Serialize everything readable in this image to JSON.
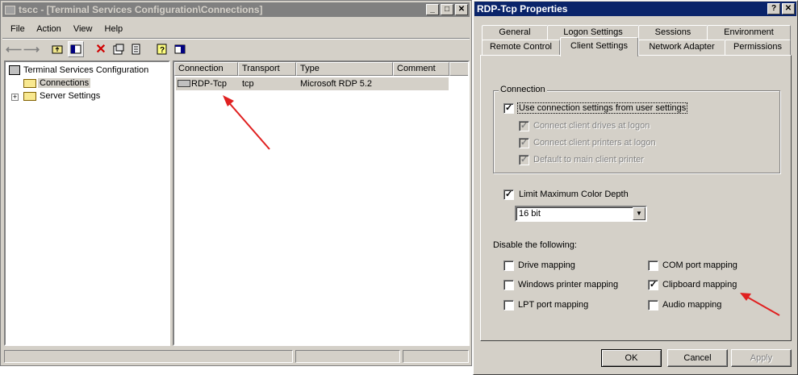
{
  "main_window": {
    "title": "tscc - [Terminal Services Configuration\\Connections]",
    "menu": [
      "File",
      "Action",
      "View",
      "Help"
    ],
    "tree": {
      "root": "Terminal Services Configuration",
      "items": [
        "Connections",
        "Server Settings"
      ]
    },
    "columns": [
      "Connection",
      "Transport",
      "Type",
      "Comment"
    ],
    "rows": [
      {
        "connection": "RDP-Tcp",
        "transport": "tcp",
        "type": "Microsoft RDP 5.2",
        "comment": ""
      }
    ]
  },
  "dialog": {
    "title": "RDP-Tcp Properties",
    "tabs_row1": [
      "General",
      "Logon Settings",
      "Sessions",
      "Environment"
    ],
    "tabs_row2": [
      "Remote Control",
      "Client Settings",
      "Network Adapter",
      "Permissions"
    ],
    "active_tab": "Client Settings",
    "connection_group": {
      "label": "Connection",
      "use_user_settings": {
        "label": "Use connection settings from user settings",
        "checked": true
      },
      "sub_options": [
        {
          "label": "Connect client drives at logon",
          "checked": true
        },
        {
          "label": "Connect client printers at logon",
          "checked": true
        },
        {
          "label": "Default to main client printer",
          "checked": true
        }
      ]
    },
    "color_depth": {
      "label": "Limit Maximum Color Depth",
      "checked": true,
      "value": "16 bit"
    },
    "disable_label": "Disable the following:",
    "disable_left": [
      {
        "label": "Drive mapping",
        "checked": false
      },
      {
        "label": "Windows printer mapping",
        "checked": false
      },
      {
        "label": "LPT port mapping",
        "checked": false
      }
    ],
    "disable_right": [
      {
        "label": "COM port mapping",
        "checked": false
      },
      {
        "label": "Clipboard mapping",
        "checked": true
      },
      {
        "label": "Audio mapping",
        "checked": false
      }
    ],
    "buttons": {
      "ok": "OK",
      "cancel": "Cancel",
      "apply": "Apply"
    }
  },
  "colors": {
    "title_active": "#0a246a",
    "title_inactive": "#808080",
    "face": "#d4d0c8",
    "arrow": "#e02020"
  }
}
